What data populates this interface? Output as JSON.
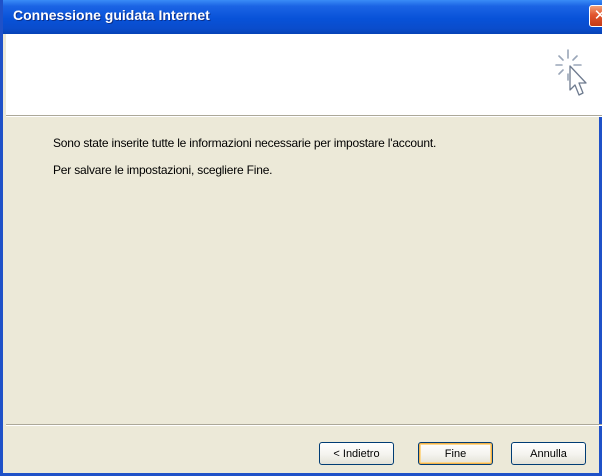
{
  "window": {
    "title": "Connessione guidata Internet",
    "close_label": "✕"
  },
  "header": {
    "icon": "wizard-cursor-icon"
  },
  "content": {
    "line1": "Sono state inserite tutte le informazioni necessarie per impostare l'account.",
    "line2": "Per salvare le impostazioni, scegliere Fine."
  },
  "buttons": {
    "back_label": "< Indietro",
    "finish_label": "Fine",
    "cancel_label": "Annulla"
  },
  "colors": {
    "titlebar": "#0852D8",
    "dialog_bg": "#ECE9D8",
    "header_bg": "#FFFFFF",
    "close_button": "#E2542D",
    "default_button_highlight": "#F3B24A"
  }
}
